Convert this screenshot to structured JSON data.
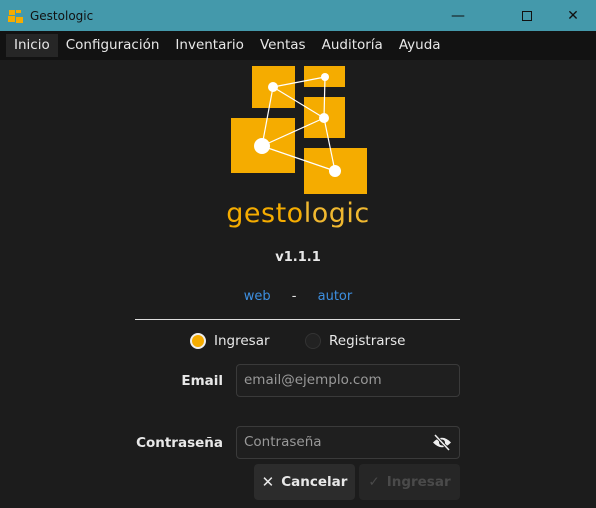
{
  "window": {
    "title": "Gestologic"
  },
  "menu": [
    "Inicio",
    "Configuración",
    "Inventario",
    "Ventas",
    "Auditoría",
    "Ayuda"
  ],
  "logo": {
    "text_a": "gesto",
    "text_b": "logic"
  },
  "version": "v1.1.1",
  "links": {
    "web": "web",
    "separator": "-",
    "autor": "autor"
  },
  "mode": {
    "login": "Ingresar",
    "register": "Registrarse",
    "selected": "Ingresar"
  },
  "form": {
    "email_label": "Email",
    "email_placeholder": "email@ejemplo.com",
    "password_label": "Contraseña",
    "password_placeholder": "Contraseña"
  },
  "buttons": {
    "cancel": "Cancelar",
    "submit": "Ingresar"
  },
  "colors": {
    "accent": "#f5ac00",
    "titlebar": "#4499ab",
    "link": "#3d8fe0"
  }
}
